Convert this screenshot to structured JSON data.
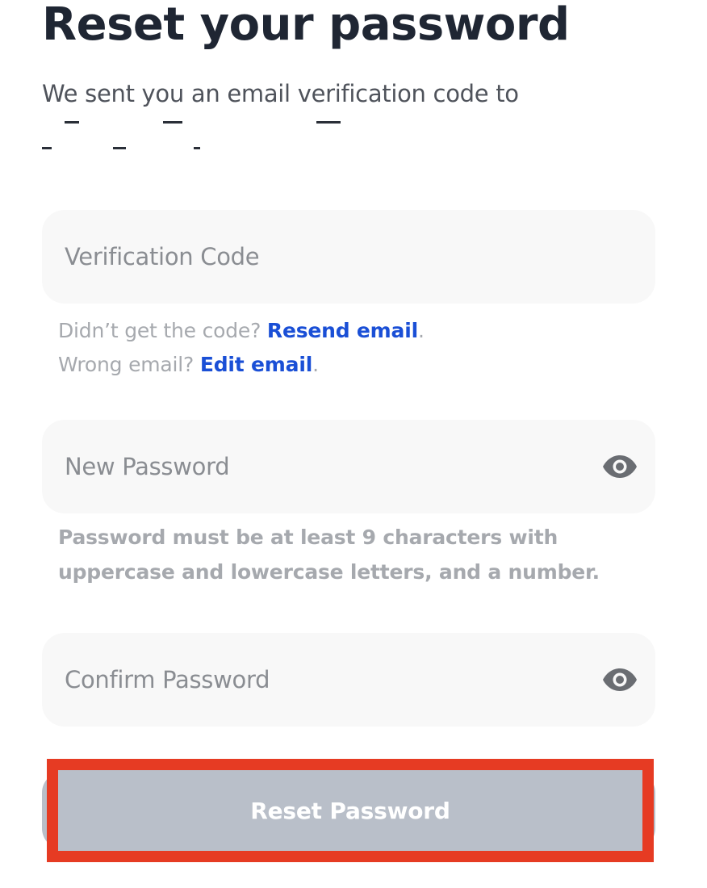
{
  "header": {
    "title": "Reset your password",
    "subtitle": "We sent you an email verification code to"
  },
  "verification": {
    "placeholder": "Verification Code",
    "value": ""
  },
  "resend": {
    "prompt": "Didn’t get the code?",
    "link": "Resend email",
    "suffix": "."
  },
  "edit": {
    "prompt": "Wrong email?",
    "link": "Edit email",
    "suffix": "."
  },
  "new_password": {
    "placeholder": "New Password",
    "value": "",
    "toggle_icon": "eye-icon"
  },
  "password_rules": {
    "line1": "Password must be at least 9 characters with",
    "line2": "uppercase and lowercase letters, and a number."
  },
  "confirm_password": {
    "placeholder": "Confirm Password",
    "value": "",
    "toggle_icon": "eye-icon"
  },
  "submit": {
    "label": "Reset Password"
  },
  "colors": {
    "title": "#1f2633",
    "link": "#1a4fd6",
    "field_bg": "#f8f8f8",
    "button_disabled": "#b9bfc9",
    "highlight": "#e63b23"
  }
}
